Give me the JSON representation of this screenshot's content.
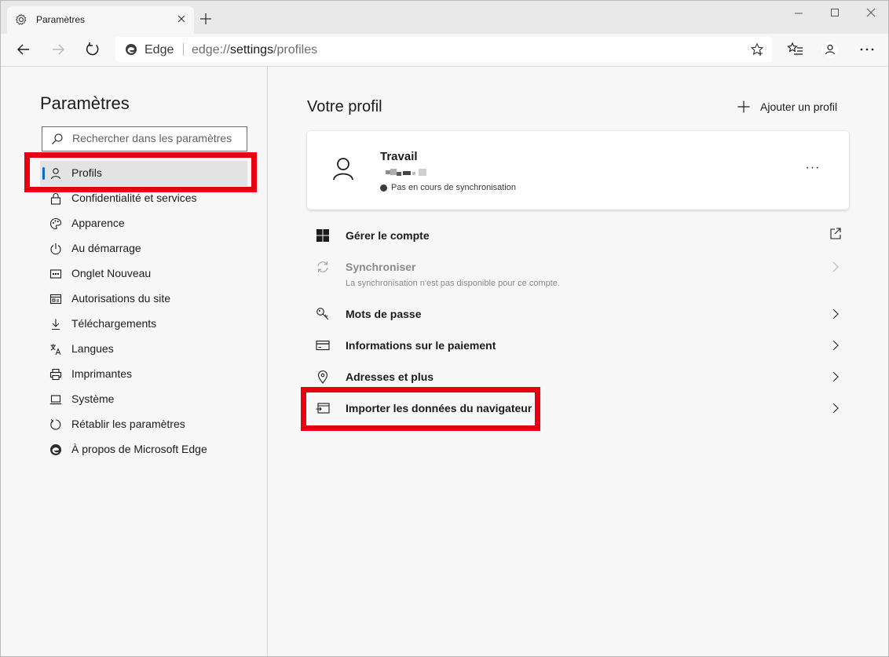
{
  "browser": {
    "tab_title": "Paramètres",
    "address_brand": "Edge",
    "url_prefix": "edge://",
    "url_host": "settings",
    "url_path": "/profiles"
  },
  "sidebar": {
    "title": "Paramètres",
    "search_placeholder": "Rechercher dans les paramètres",
    "items": [
      {
        "label": "Profils",
        "icon": "person-icon",
        "active": true
      },
      {
        "label": "Confidentialité et services",
        "icon": "lock-icon"
      },
      {
        "label": "Apparence",
        "icon": "palette-icon"
      },
      {
        "label": "Au démarrage",
        "icon": "power-icon"
      },
      {
        "label": "Onglet Nouveau",
        "icon": "new-tab-page-icon"
      },
      {
        "label": "Autorisations du site",
        "icon": "site-permissions-icon"
      },
      {
        "label": "Téléchargements",
        "icon": "download-icon"
      },
      {
        "label": "Langues",
        "icon": "languages-icon"
      },
      {
        "label": "Imprimantes",
        "icon": "printer-icon"
      },
      {
        "label": "Système",
        "icon": "laptop-icon"
      },
      {
        "label": "Rétablir les paramètres",
        "icon": "reset-icon"
      },
      {
        "label": "À propos de Microsoft Edge",
        "icon": "edge-logo-icon"
      }
    ]
  },
  "main": {
    "title": "Votre profil",
    "add_profile_label": "Ajouter un profil",
    "profile": {
      "name": "Travail",
      "sync_status": "Pas en cours de synchronisation"
    },
    "rows": [
      {
        "label": "Gérer le compte",
        "icon": "windows-logo-icon",
        "trailing": "external-link-icon"
      },
      {
        "label": "Synchroniser",
        "sub": "La synchronisation n'est pas disponible pour ce compte.",
        "icon": "sync-icon",
        "disabled": true,
        "trailing": "chevron-right-icon"
      },
      {
        "label": "Mots de passe",
        "icon": "key-icon",
        "trailing": "chevron-right-icon"
      },
      {
        "label": "Informations sur le paiement",
        "icon": "credit-card-icon",
        "trailing": "chevron-right-icon"
      },
      {
        "label": "Adresses et plus",
        "icon": "location-pin-icon",
        "trailing": "chevron-right-icon"
      },
      {
        "label": "Importer les données du navigateur",
        "icon": "import-icon",
        "trailing": "chevron-right-icon"
      }
    ]
  },
  "colors": {
    "highlight": "#e60012",
    "accent": "#0f6cbd"
  }
}
